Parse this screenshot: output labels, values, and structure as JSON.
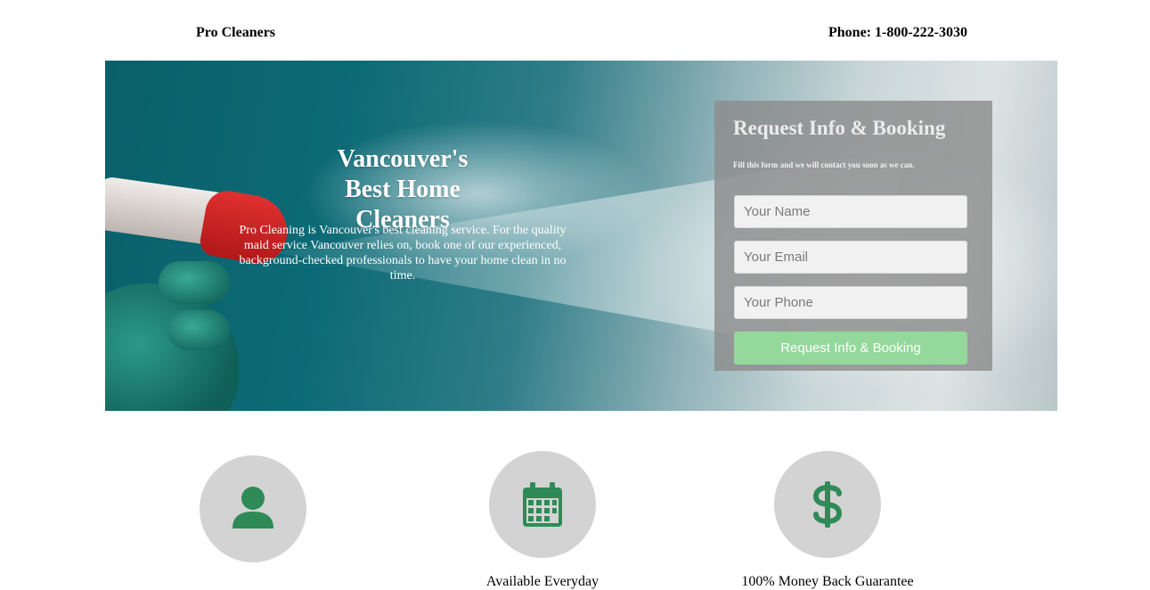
{
  "header": {
    "brand": "Pro Cleaners",
    "phone": "Phone: 1-800-222-3030"
  },
  "hero": {
    "title": "Vancouver's Best Home Cleaners",
    "description": "Pro Cleaning is Vancouver's best cleaning service. For the quality maid service Vancouver relies on, book one of our experienced, background-checked professionals to have your home clean in no time."
  },
  "form": {
    "title": "Request Info & Booking",
    "subtitle": "Fill this form and we will contact you soon as we can.",
    "name_placeholder": "Your Name",
    "email_placeholder": "Your Email",
    "phone_placeholder": "Your Phone",
    "submit_label": "Request Info & Booking"
  },
  "features": [
    {
      "icon": "user-icon",
      "label": ""
    },
    {
      "icon": "calendar-icon",
      "label": "Available Everyday"
    },
    {
      "icon": "dollar-icon",
      "label": "100% Money Back Guarantee"
    }
  ],
  "colors": {
    "icon": "#2e8b57",
    "circle": "#d3d3d3",
    "submit": "#94d99b",
    "hero_teal": "#0c6b76"
  }
}
